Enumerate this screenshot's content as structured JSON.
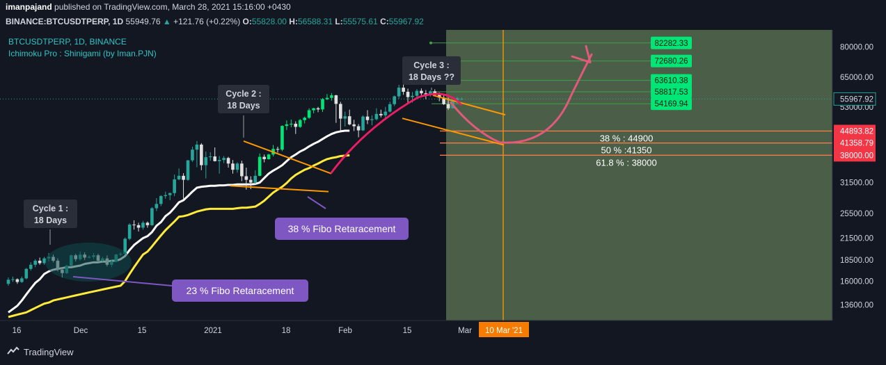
{
  "header": {
    "author": "imanpajand",
    "published_text": "published on TradingView.com, March 28, 2021 15:16:00 +0430"
  },
  "symbol": {
    "name": "BINANCE:BTCUSDTPERP, 1D",
    "last": "55949.76",
    "change": "+121.76 (+0.22%)",
    "open_label": "O:",
    "open": "55828.00",
    "high_label": "H:",
    "high": "56588.31",
    "low_label": "L:",
    "low": "55575.61",
    "close_label": "C:",
    "close": "55967.92"
  },
  "legend": {
    "series_title": "BTCUSDTPERP, 1D, BINANCE",
    "indicator": "Ichimoku Pro : Shinigami (by Iman.PJN)"
  },
  "footer": {
    "brand": "TradingView"
  },
  "colors": {
    "background": "#131722",
    "forecast_zone": "#4a5e48",
    "up_candle": "#26a69a",
    "bright_up": "#00e676",
    "down_candle": "#e0e0e0",
    "yellow_line": "#ffeb3b",
    "white_line": "#ffffff",
    "orange_trend": "#ff9800",
    "pink_arc": "#e91e63",
    "pink_arrow": "#e05a7a",
    "purple_label": "#7e57c2",
    "red_tag": "#f23645",
    "green_tag": "#00e676"
  },
  "chart_data": {
    "type": "candlestick",
    "symbol": "BTCUSDTPERP",
    "timeframe": "1D",
    "y_scale": "log",
    "ylim": [
      12200,
      90000
    ],
    "price_ticks": [
      80000.0,
      65000.0,
      53000.0,
      31500.0,
      25500.0,
      21500.0,
      18500.0,
      16000.0,
      13600.0
    ],
    "time_ticks": [
      "16",
      "Dec",
      "15",
      "2021",
      "18",
      "Feb",
      "15",
      "Mar",
      "10 Mar '21"
    ],
    "fib_levels": [
      {
        "label": "38 % : 44900",
        "value": 44900,
        "tag": "44893.82"
      },
      {
        "label": "50 % :41350",
        "value": 41350,
        "tag": "41358.79"
      },
      {
        "label": "61.8 % : 38000",
        "value": 38000,
        "tag": "38000.00"
      }
    ],
    "targets": [
      "82282.33",
      "72680.26",
      "63610.38",
      "58817.53",
      "54169.94"
    ],
    "current_price": "55967.92",
    "annotations": [
      {
        "text_line1": "Cycle 1 :",
        "text_line2": "18 Days"
      },
      {
        "text_line1": "Cycle 2 :",
        "text_line2": "18 Days"
      },
      {
        "text_line1": "Cycle 3 :",
        "text_line2": "18 Days ??"
      },
      {
        "text": "23 % Fibo Retaracement"
      },
      {
        "text": "38 % Fibo Retaracement"
      }
    ],
    "candles": [
      [
        15700,
        16400,
        15500,
        16150
      ],
      [
        16150,
        16500,
        15900,
        16200
      ],
      [
        16200,
        16300,
        15700,
        15900
      ],
      [
        15900,
        16500,
        15800,
        16300
      ],
      [
        16300,
        17500,
        16200,
        17400
      ],
      [
        17400,
        18200,
        17200,
        17900
      ],
      [
        17900,
        18600,
        17600,
        18400
      ],
      [
        18400,
        18800,
        17900,
        18100
      ],
      [
        18100,
        18900,
        17900,
        18700
      ],
      [
        18700,
        19400,
        18300,
        18900
      ],
      [
        18900,
        19200,
        18200,
        18400
      ],
      [
        18400,
        18700,
        17100,
        17300
      ],
      [
        17300,
        17600,
        16400,
        16900
      ],
      [
        16900,
        17900,
        16800,
        17800
      ],
      [
        17800,
        19200,
        17700,
        19100
      ],
      [
        19100,
        19300,
        18300,
        18600
      ],
      [
        18600,
        19600,
        18400,
        19200
      ],
      [
        19200,
        19500,
        18500,
        18800
      ],
      [
        18800,
        19100,
        18700,
        18900
      ],
      [
        18900,
        19400,
        18600,
        19100
      ],
      [
        19100,
        19300,
        18200,
        18400
      ],
      [
        18400,
        18900,
        18300,
        18700
      ],
      [
        18700,
        19100,
        17700,
        17900
      ],
      [
        17900,
        18500,
        17600,
        18300
      ],
      [
        18300,
        19300,
        18200,
        19200
      ],
      [
        19200,
        19500,
        19000,
        19300
      ],
      [
        19300,
        21600,
        19200,
        21400
      ],
      [
        21400,
        23800,
        21200,
        23600
      ],
      [
        23600,
        24300,
        22800,
        23500
      ],
      [
        23500,
        23900,
        22500,
        23100
      ],
      [
        23100,
        24200,
        22800,
        23900
      ],
      [
        23900,
        24100,
        23100,
        23500
      ],
      [
        23500,
        26600,
        23400,
        26400
      ],
      [
        26400,
        28300,
        25900,
        27200
      ],
      [
        27200,
        28900,
        26800,
        28700
      ],
      [
        28700,
        29600,
        28200,
        28900
      ],
      [
        28900,
        29400,
        27900,
        29300
      ],
      [
        29300,
        33300,
        28700,
        32200
      ],
      [
        32200,
        34700,
        32000,
        33000
      ],
      [
        33000,
        33600,
        28200,
        32100
      ],
      [
        32100,
        36800,
        31900,
        36700
      ],
      [
        36700,
        40300,
        36300,
        39500
      ],
      [
        39500,
        41900,
        35000,
        40900
      ],
      [
        40900,
        41300,
        34300,
        35500
      ],
      [
        35500,
        39000,
        32400,
        37500
      ],
      [
        37500,
        38800,
        36600,
        37700
      ],
      [
        37700,
        40100,
        36400,
        36500
      ],
      [
        36500,
        37800,
        33500,
        36800
      ],
      [
        36800,
        37800,
        36000,
        37300
      ],
      [
        37300,
        37600,
        34900,
        35900
      ],
      [
        35900,
        36800,
        33500,
        34400
      ],
      [
        34400,
        36200,
        33700,
        35900
      ],
      [
        35900,
        36600,
        31800,
        32900
      ],
      [
        32900,
        34900,
        30000,
        32100
      ],
      [
        32100,
        32900,
        30100,
        31500
      ],
      [
        31500,
        34300,
        31200,
        33000
      ],
      [
        33000,
        38500,
        32900,
        37600
      ],
      [
        37600,
        38200,
        36200,
        37000
      ],
      [
        37000,
        38400,
        36900,
        38200
      ],
      [
        38200,
        40800,
        37700,
        39700
      ],
      [
        39700,
        40300,
        38700,
        39500
      ],
      [
        39500,
        46700,
        39100,
        46500
      ],
      [
        46500,
        48300,
        45200,
        47000
      ],
      [
        47000,
        48600,
        46100,
        47200
      ],
      [
        47200,
        48000,
        44000,
        46200
      ],
      [
        46200,
        48800,
        45900,
        48400
      ],
      [
        48400,
        49600,
        47300,
        49200
      ],
      [
        49200,
        52500,
        48800,
        51800
      ],
      [
        51800,
        52700,
        50700,
        52500
      ],
      [
        52500,
        53000,
        51100,
        52100
      ],
      [
        52100,
        56300,
        51200,
        55900
      ],
      [
        55900,
        57900,
        55500,
        56400
      ],
      [
        56400,
        58300,
        55300,
        57400
      ],
      [
        57400,
        57600,
        47500,
        54100
      ],
      [
        54100,
        54900,
        45000,
        48900
      ],
      [
        48900,
        51300,
        46300,
        49700
      ],
      [
        49700,
        52000,
        46700,
        47000
      ],
      [
        47000,
        48500,
        44900,
        46400
      ],
      [
        46400,
        47100,
        43000,
        45100
      ],
      [
        45100,
        50000,
        44900,
        49600
      ],
      [
        49600,
        51800,
        47100,
        48400
      ],
      [
        48400,
        50000,
        46700,
        48700
      ],
      [
        48700,
        52500,
        48300,
        50500
      ],
      [
        50500,
        52000,
        49300,
        50000
      ],
      [
        50000,
        53000,
        49000,
        51300
      ],
      [
        51300,
        54900,
        51000,
        54000
      ],
      [
        54000,
        57300,
        53300,
        57000
      ],
      [
        57000,
        61700,
        56100,
        60500
      ],
      [
        60500,
        61800,
        57600,
        58800
      ],
      [
        58800,
        60100,
        54600,
        56700
      ],
      [
        56700,
        58700,
        54600,
        57200
      ],
      [
        57200,
        59900,
        56600,
        59200
      ],
      [
        59200,
        60200,
        56600,
        58200
      ],
      [
        58200,
        59500,
        55900,
        57800
      ],
      [
        57800,
        59400,
        56900,
        59000
      ],
      [
        59000,
        59800,
        57100,
        57500
      ],
      [
        57500,
        58500,
        55100,
        56500
      ],
      [
        56500,
        57500,
        53700,
        54000
      ],
      [
        54000,
        56500,
        51900,
        52500
      ],
      [
        52500,
        55800,
        52400,
        55500
      ],
      [
        55500,
        56800,
        54000,
        56300
      ],
      [
        55828,
        56588,
        55575,
        55968
      ]
    ],
    "tenkan_white": [
      12900,
      13200,
      13500,
      14000,
      14600,
      15200,
      15800,
      16200,
      16800,
      17100,
      17300,
      17400,
      17500,
      17600,
      17600,
      17700,
      17800,
      18000,
      18100,
      18200,
      18200,
      18300,
      18300,
      18400,
      18400,
      18600,
      19000,
      19800,
      20500,
      21000,
      21500,
      21800,
      22400,
      23400,
      24000,
      25000,
      25600,
      26500,
      27500,
      27900,
      28700,
      29600,
      30400,
      30600,
      30700,
      30800,
      30800,
      30900,
      30900,
      31000,
      31000,
      31100,
      31100,
      31100,
      31100,
      31200,
      31500,
      32500,
      33500,
      34200,
      34800,
      35500,
      36500,
      37500,
      38200,
      39000,
      39600,
      40400,
      41100,
      41700,
      42500,
      43300,
      44000,
      44500,
      44800,
      45000,
      45000
    ],
    "kijun_yellow": [
      12500,
      12600,
      12700,
      12800,
      12900,
      13100,
      13300,
      13500,
      13700,
      13800,
      14000,
      14100,
      14200,
      14300,
      14400,
      14500,
      14600,
      14700,
      14800,
      14900,
      15000,
      15100,
      15200,
      15300,
      15400,
      15500,
      16000,
      16800,
      17600,
      18400,
      19200,
      19600,
      20300,
      21100,
      21900,
      22700,
      23400,
      24100,
      24900,
      25000,
      25200,
      25500,
      25800,
      26000,
      26200,
      26300,
      26300,
      26300,
      26300,
      26300,
      26300,
      26400,
      26500,
      26500,
      26600,
      26700,
      27200,
      27800,
      28600,
      29400,
      30000,
      30600,
      31400,
      32400,
      33200,
      33800,
      34400,
      34800,
      35400,
      35900,
      36500,
      37000,
      37300,
      37500,
      37800,
      37900,
      38000
    ]
  }
}
